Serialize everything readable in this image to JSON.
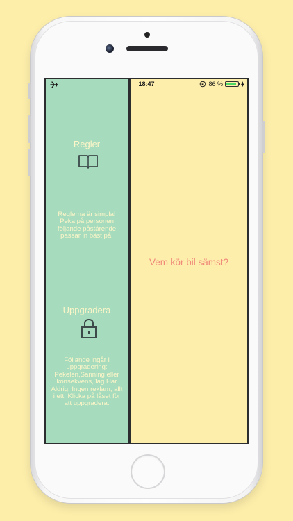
{
  "status_bar": {
    "time": "18:47",
    "battery_text": "86 %",
    "battery_level": 0.86,
    "left_icon": "airplane-icon",
    "right_icons": [
      "rotation-lock-icon",
      "battery-icon",
      "charging-icon"
    ]
  },
  "sidebar": {
    "rules": {
      "title": "Regler",
      "icon": "book-icon",
      "text": "Reglerna är simpla! Peka på personen följande påstårende passar in bäst på."
    },
    "upgrade": {
      "title": "Uppgradera",
      "icon": "lock-icon",
      "text": "Följande ingår i uppgradering: Pekelen,Sanning eller konsekvens,Jag Har Aldrig, Ingen reklam, allt i ett! Klicka på låset för att uppgradera."
    }
  },
  "main": {
    "question": "Vem kör bil sämst?"
  },
  "colors": {
    "background": "#fdeeaa",
    "sidebar": "#a6dbbd",
    "main": "#feeeab",
    "sidebar_text": "#fdf6c8",
    "question_text": "#f08a7a",
    "icon": "#3c4a4a"
  }
}
